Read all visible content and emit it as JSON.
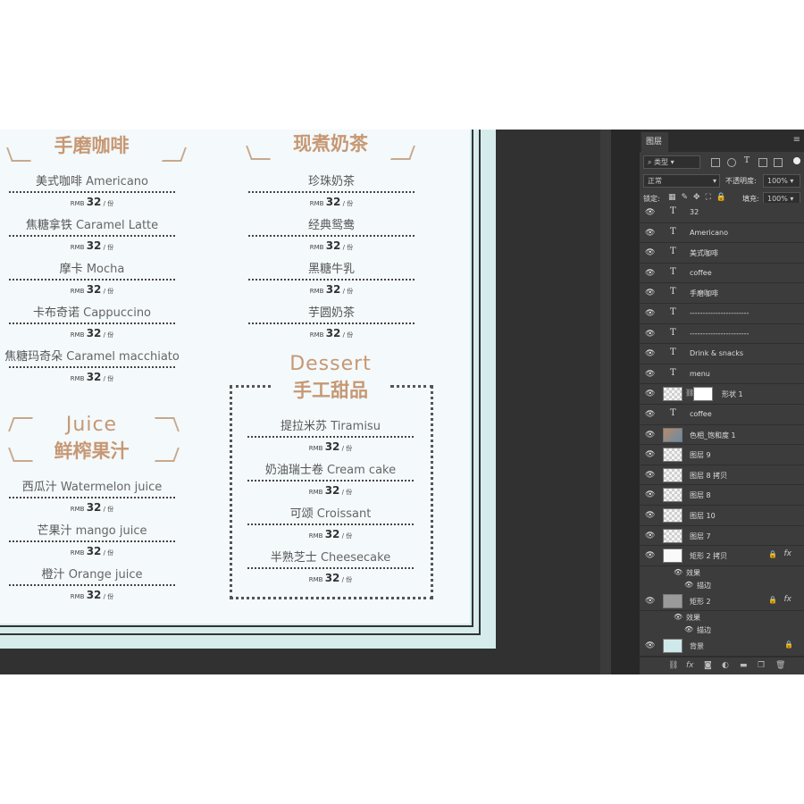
{
  "menu": {
    "sections": {
      "coffee": {
        "title": "手磨咖啡",
        "items": [
          {
            "cn": "美式咖啡",
            "en": "Americano"
          },
          {
            "cn": "焦糖拿铁",
            "en": "Caramel Latte"
          },
          {
            "cn": "摩卡",
            "en": "Mocha"
          },
          {
            "cn": "卡布奇诺",
            "en": "Cappuccino"
          },
          {
            "cn": "焦糖玛奇朵",
            "en": "Caramel macchiato"
          }
        ]
      },
      "milktea": {
        "title": "现煮奶茶",
        "items": [
          {
            "cn": "珍珠奶茶",
            "en": ""
          },
          {
            "cn": "经典鸳鸯",
            "en": ""
          },
          {
            "cn": "黑糖牛乳",
            "en": ""
          },
          {
            "cn": "芋圆奶茶",
            "en": ""
          }
        ]
      },
      "juice": {
        "title_en": "Juice",
        "title": "鲜榨果汁",
        "items": [
          {
            "cn": "西瓜汁",
            "en": "Watermelon juice"
          },
          {
            "cn": "芒果汁",
            "en": "mango juice"
          },
          {
            "cn": "橙汁",
            "en": "Orange juice"
          }
        ]
      },
      "dessert": {
        "title_en": "Dessert",
        "title": "手工甜品",
        "items": [
          {
            "cn": "提拉米苏",
            "en": "Tiramisu"
          },
          {
            "cn": "奶油瑞士卷",
            "en": "Cream cake"
          },
          {
            "cn": "可颂",
            "en": "Croissant"
          },
          {
            "cn": "半熟芝士",
            "en": "Cheesecake"
          }
        ]
      }
    },
    "price": {
      "currency": "RMB",
      "value": "32",
      "unit": "/ 份"
    }
  },
  "panel": {
    "tab": "图层",
    "filter_kind": "类型",
    "blend_mode": "正常",
    "opacity_label": "不透明度:",
    "opacity_value": "100%",
    "lock_label": "锁定:",
    "fill_label": "填充:",
    "fill_value": "100%",
    "layers": [
      {
        "kind": "text",
        "name": "32"
      },
      {
        "kind": "text",
        "name": "Americano"
      },
      {
        "kind": "text",
        "name": "美式咖啡"
      },
      {
        "kind": "text",
        "name": "coffee"
      },
      {
        "kind": "text",
        "name": "手磨咖啡"
      },
      {
        "kind": "text",
        "name": "-----------------------"
      },
      {
        "kind": "text",
        "name": "-----------------------"
      },
      {
        "kind": "text",
        "name": "Drink & snacks"
      },
      {
        "kind": "text",
        "name": "menu"
      },
      {
        "kind": "shape",
        "name": "形状 1"
      },
      {
        "kind": "text",
        "name": "coffee"
      },
      {
        "kind": "adjust",
        "name": "色相_饱和度 1"
      },
      {
        "kind": "pixel",
        "name": "图层 9"
      },
      {
        "kind": "pixel",
        "name": "图层 8 拷贝"
      },
      {
        "kind": "pixel",
        "name": "图层 8"
      },
      {
        "kind": "pixel",
        "name": "图层 10"
      },
      {
        "kind": "pixel",
        "name": "图层 7"
      }
    ],
    "fx_groups": [
      {
        "name": "矩形 2 拷贝",
        "effects_label": "效果",
        "effect": "描边"
      },
      {
        "name": "矩形 2",
        "effects_label": "效果",
        "effect": "描边"
      }
    ],
    "background": {
      "name": "背景"
    },
    "text_glyph": "T",
    "fx_glyph": "fx"
  }
}
